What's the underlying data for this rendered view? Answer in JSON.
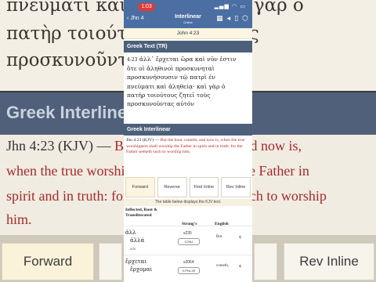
{
  "background": {
    "greek_lines": [
      "πνεύματι καὶ ἀληθείᾳ· καὶ γὰρ ὁ",
      "πατὴρ τοιούτους ζητεῖ τοὺς",
      "προσκυνοῦντας αὐτόν"
    ],
    "band_title": "Greek Interlinear",
    "kjv_lines": [
      {
        "ref": "Jhn 4:23 (KJV) — ",
        "text": "But the hour cometh, and now is,"
      },
      {
        "ref": "",
        "text": "when the true worshippers shall worship the Father in"
      },
      {
        "ref": "",
        "text": "spirit and in truth: for the Father seeketh such to worship"
      },
      {
        "ref": "",
        "text": "him."
      }
    ],
    "buttons": [
      "Forward",
      "Reverse",
      "Find Inline",
      "Rev Inline"
    ]
  },
  "status_bar": {
    "time": "1:03",
    "icons": "▂▄▆ ◠ ▭"
  },
  "nav": {
    "back_label": "Jhn 4",
    "title": "Interlinear",
    "subtitle": "Online"
  },
  "reference": "John 4:23",
  "greek_text_section": {
    "heading": "Greek Text (TR)",
    "verse_number": "4:23",
    "lines": [
      "ἀλλ᾽ ἔρχεται ὥρα καὶ νῦν ἐστιν",
      "ὅτε οἱ ἀληθινοὶ προσκυνηταὶ",
      "προσκυνήσουσιν τῷ πατρὶ ἐν",
      "πνεύματι καὶ ἀληθείᾳ· καὶ γὰρ ὁ",
      "πατὴρ τοιούτους ζητεῖ τοὺς",
      "προσκυνοῦντας αὐτόν"
    ]
  },
  "interlinear_section": {
    "heading": "Greek Interlinear",
    "kjv_ref": "Jhn 4:23 (KJV) — ",
    "kjv_text": "But the hour cometh, and now is, when the true worshippers shall worship the Father in spirit and in truth: for the Father seeketh such to worship him.",
    "buttons": [
      {
        "label": "Forward",
        "active": true
      },
      {
        "label": "Reverse",
        "active": false
      },
      {
        "label": "Find Inline",
        "active": false
      },
      {
        "label": "Rev Inline",
        "active": false
      }
    ],
    "info": "The table below displays the KJV text.",
    "table_headers": {
      "col1": "Inflected, Root & Transliterated",
      "col2": "Strong's",
      "col3": "English"
    },
    "rows": [
      {
        "inflected": "ἀλλ",
        "root": "ἀλλά",
        "translit": "alla",
        "strongs": "s235",
        "code": "CONJ",
        "english": "But"
      },
      {
        "inflected": "ἔρχεται",
        "root": "ἔρχομαι",
        "translit": "",
        "strongs": "s2064",
        "code": "V-PNI-3S",
        "english": "cometh,"
      }
    ]
  }
}
